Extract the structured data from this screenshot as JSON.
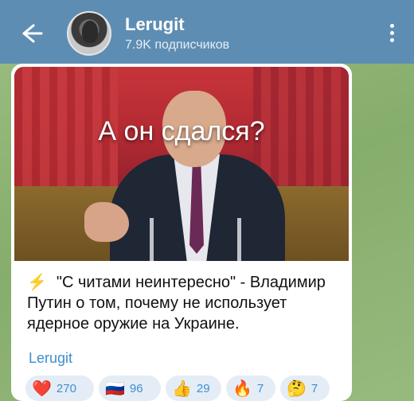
{
  "header": {
    "channel_name": "Lerugit",
    "subscribers": "7.9K подписчиков"
  },
  "post": {
    "image_caption": "А он сдался?",
    "text": "\"С читами неинтересно\" - Владимир Путин о том, почему не использует ядерное оружие на Украине.",
    "channel_link": "Lerugit"
  },
  "reactions": [
    {
      "emoji": "❤️",
      "count": "270"
    },
    {
      "emoji": "🇷🇺",
      "count": "96"
    },
    {
      "emoji": "👍",
      "count": "29"
    },
    {
      "emoji": "🔥",
      "count": "7"
    },
    {
      "emoji": "🤔",
      "count": "7"
    }
  ],
  "icons": {
    "back": "back-arrow-icon",
    "menu": "more-vertical-icon",
    "bolt": "lightning-icon"
  },
  "colors": {
    "header": "#5e8db3",
    "accent": "#3e8ed0",
    "background": "#8fb377"
  }
}
